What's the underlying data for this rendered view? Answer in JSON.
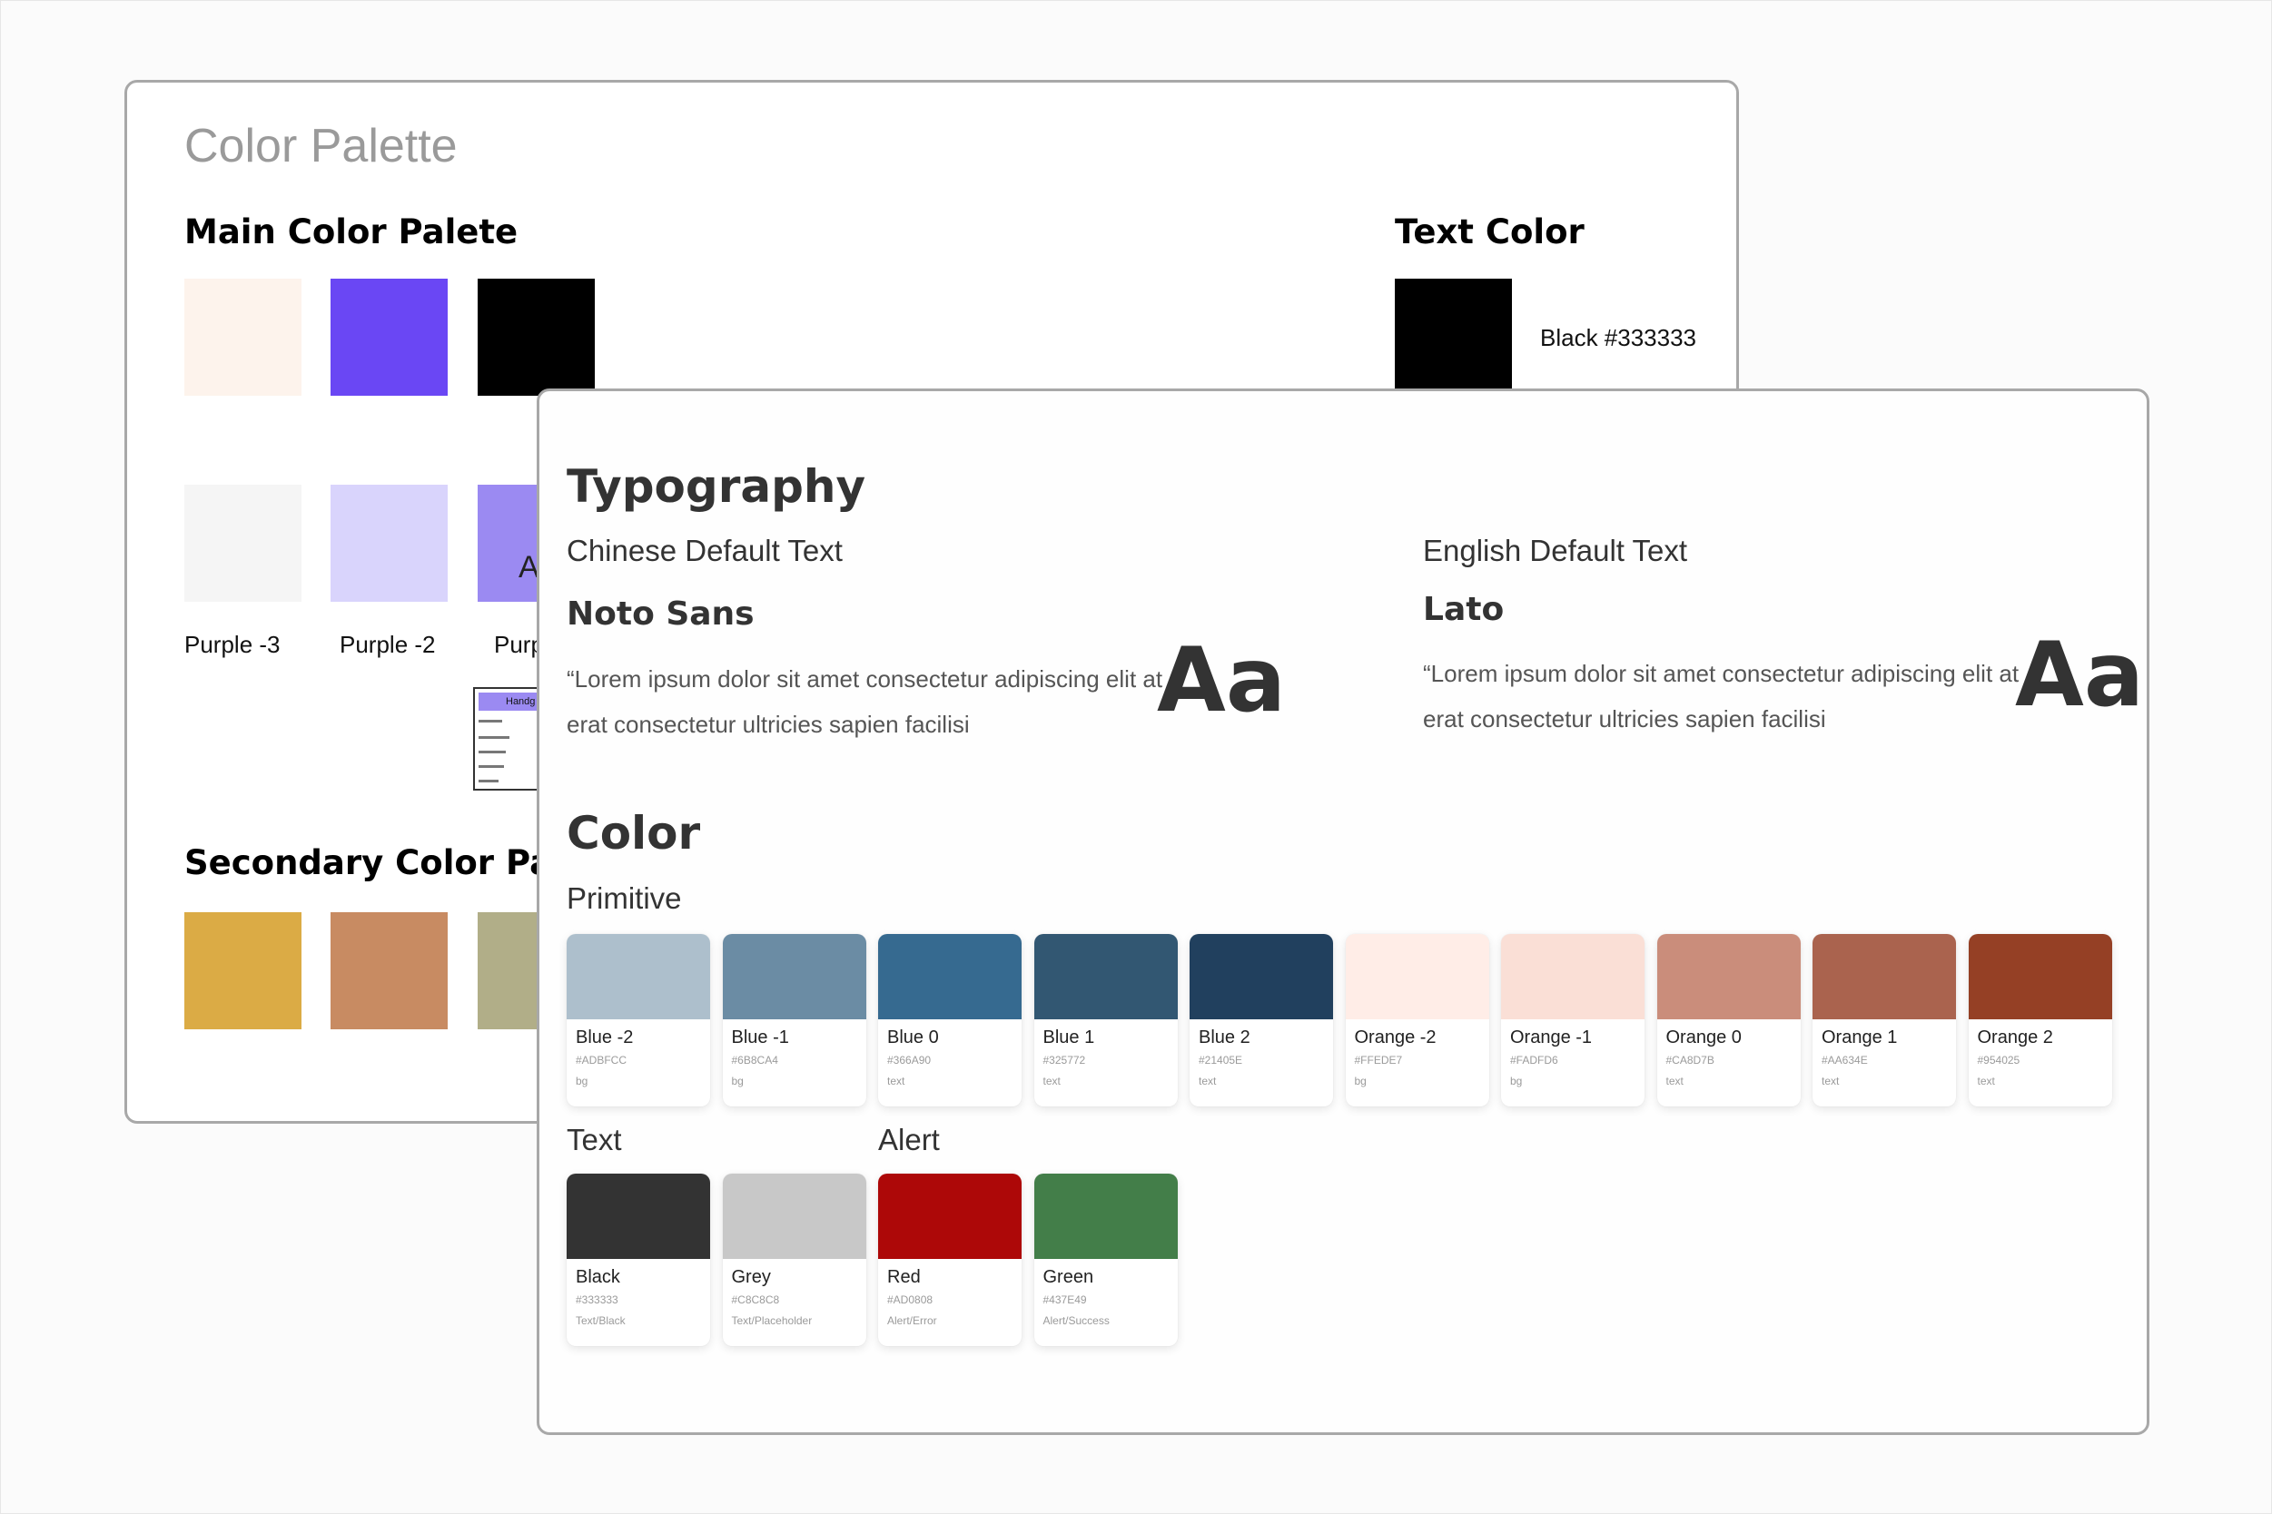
{
  "back_card": {
    "title": "Color Palette",
    "main_heading": "Main Color Palete",
    "text_color_heading": "Text Color",
    "text_color_label": "Black #333333",
    "secondary_heading": "Secondary Color Pa",
    "main_row1_colors": [
      "#fdf3ec",
      "#6a47f4",
      "#000000"
    ],
    "main_row2_colors": [
      "#f5f5f5",
      "#d9d4fc",
      "#9b8af2"
    ],
    "swatch_overlay_letter": "A",
    "main_row2_labels": [
      "Purple -3",
      "Purple -2",
      "Purp"
    ],
    "mini_thumb_label": "Handg",
    "secondary_colors": [
      "#dbab45",
      "#c88b62",
      "#b1ae88"
    ],
    "text_color_swatch": "#000000"
  },
  "front_card": {
    "heading": "Typography",
    "chinese": {
      "label": "Chinese Default Text",
      "font": "Noto Sans",
      "sample": "“Lorem ipsum dolor sit amet consectetur adipiscing elit at erat consectetur ultricies sapien facilisi",
      "aa": "Aa"
    },
    "english": {
      "label": "English Default Text",
      "font": "Lato",
      "sample": "“Lorem ipsum dolor sit amet consectetur adipiscing elit at erat consectetur ultricies sapien facilisi",
      "aa": "Aa"
    },
    "color_heading": "Color",
    "primitive_label": "Primitive",
    "text_label": "Text",
    "alert_label": "Alert",
    "primitive": [
      {
        "name": "Blue -2",
        "hex": "#ADBFCC",
        "use": "bg"
      },
      {
        "name": "Blue -1",
        "hex": "#6B8CA4",
        "use": "bg"
      },
      {
        "name": "Blue 0",
        "hex": "#366A90",
        "use": "text"
      },
      {
        "name": "Blue 1",
        "hex": "#325772",
        "use": "text"
      },
      {
        "name": "Blue 2",
        "hex": "#21405E",
        "use": "text"
      },
      {
        "name": "Orange -2",
        "hex": "#FFEDE7",
        "use": "bg"
      },
      {
        "name": "Orange -1",
        "hex": "#FADFD6",
        "use": "bg"
      },
      {
        "name": "Orange 0",
        "hex": "#CA8D7B",
        "use": "text"
      },
      {
        "name": "Orange 1",
        "hex": "#AA634E",
        "use": "text"
      },
      {
        "name": "Orange 2",
        "hex": "#954025",
        "use": "text"
      }
    ],
    "text_colors": [
      {
        "name": "Black",
        "hex": "#333333",
        "use": "Text/Black"
      },
      {
        "name": "Grey",
        "hex": "#C8C8C8",
        "use": "Text/Placeholder"
      }
    ],
    "alert_colors": [
      {
        "name": "Red",
        "hex": "#AD0808",
        "use": "Alert/Error"
      },
      {
        "name": "Green",
        "hex": "#437E49",
        "use": "Alert/Success"
      }
    ]
  }
}
